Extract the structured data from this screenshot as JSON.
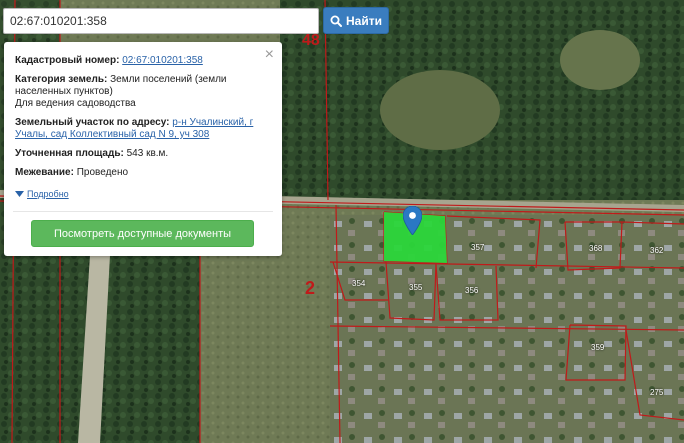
{
  "search": {
    "value": "02:67:010201:358",
    "button_label": "Найти"
  },
  "popup": {
    "cadastral_label": "Кадастровый номер:",
    "cadastral_value": "02:67:010201:358",
    "category_label": "Категория земель:",
    "category_value": "Земли поселений (земли населенных пунктов)",
    "purpose_value": "Для ведения садоводства",
    "address_label": "Земельный участок по адресу:",
    "address_value": "р-н Учалинский, г Учалы, сад Коллективный сад N 9, уч 308",
    "area_label": "Уточненная площадь:",
    "area_value": "543 кв.м.",
    "survey_label": "Межевание:",
    "survey_value": "Проведено",
    "details_label": "Подробно",
    "docs_button_label": "Посмотреть доступные документы"
  },
  "map_labels": {
    "block_48": "48",
    "block_2": "2",
    "plot_357": "357",
    "plot_354": "354",
    "plot_355": "355",
    "plot_356": "356",
    "plot_368": "368",
    "plot_362": "362",
    "plot_359": "359",
    "plot_275": "275"
  },
  "colors": {
    "accent_blue": "#3a7dbf",
    "button_green": "#5cb85c",
    "highlight_plot": "#2bd63a",
    "boundary_red": "#c01a1a"
  },
  "icons": {
    "search": "search-icon",
    "close": "close-icon",
    "details": "caret-down-icon",
    "marker": "map-marker-icon"
  }
}
